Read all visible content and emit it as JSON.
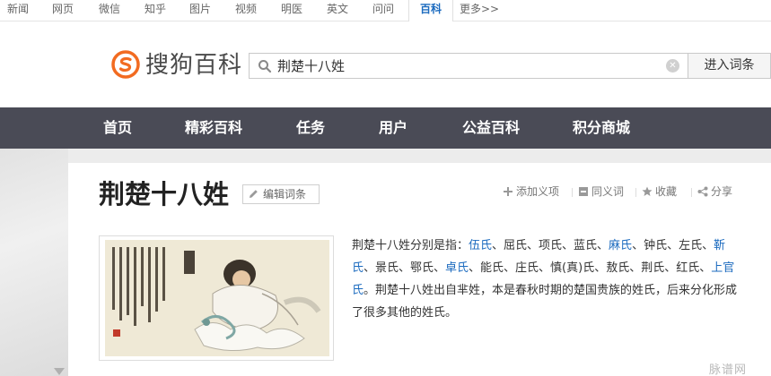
{
  "top_channels": [
    {
      "label": "新闻"
    },
    {
      "label": "网页"
    },
    {
      "label": "微信"
    },
    {
      "label": "知乎"
    },
    {
      "label": "图片"
    },
    {
      "label": "视频"
    },
    {
      "label": "明医"
    },
    {
      "label": "英文"
    },
    {
      "label": "问问"
    },
    {
      "label": "百科",
      "active": true
    },
    {
      "label": "更多>>"
    }
  ],
  "brand": {
    "name": "搜狗百科",
    "accent": "#f26b21"
  },
  "search": {
    "value": "荆楚十八姓",
    "enter_label": "进入词条"
  },
  "nav": [
    "首页",
    "精彩百科",
    "任务",
    "用户",
    "公益百科",
    "积分商城"
  ],
  "entry": {
    "title": "荆楚十八姓",
    "edit_label": "编辑词条",
    "actions": {
      "add_sense": "添加义项",
      "synonym": "同义词",
      "favorite": "收藏",
      "share": "分享"
    },
    "summary_parts": [
      {
        "text": "荆楚十八姓分别是指：",
        "link": false
      },
      {
        "text": "伍氏",
        "link": true
      },
      {
        "text": "、屈氏、项氏、蓝氏、",
        "link": false
      },
      {
        "text": "麻氏",
        "link": true
      },
      {
        "text": "、钟氏、左氏、",
        "link": false
      },
      {
        "text": "靳氏",
        "link": true
      },
      {
        "text": "、景氏、鄂氏、",
        "link": false
      },
      {
        "text": "卓氏",
        "link": true
      },
      {
        "text": "、能氏、庄氏、慎(真)氏、敖氏、荆氏、红氏、",
        "link": false
      },
      {
        "text": "上官氏",
        "link": true
      },
      {
        "text": "。荆楚十八姓出自芈姓，本是春秋时期的楚国贵族的姓氏，后来分化形成了很多其他的姓氏。",
        "link": false
      }
    ]
  },
  "watermark": "脉谱网",
  "colors": {
    "nav_bg": "#4a4b56",
    "link": "#1c6bbf"
  }
}
